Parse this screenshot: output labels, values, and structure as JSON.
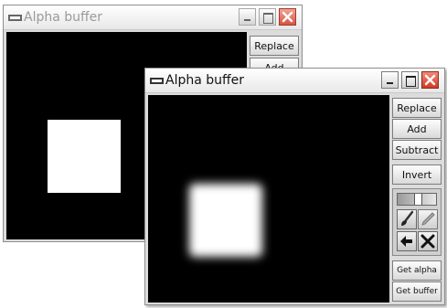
{
  "back_window": {
    "title": "Alpha buffer",
    "buttons": {
      "replace": "Replace",
      "add": "Add"
    }
  },
  "front_window": {
    "title": "Alpha buffer",
    "buttons": {
      "replace": "Replace",
      "add": "Add",
      "subtract": "Subtract",
      "invert": "Invert",
      "get_alpha": "Get alpha",
      "get_buffer": "Get buffer"
    },
    "tools": [
      "brush-icon",
      "pencil-icon",
      "arrow-icon",
      "clear-icon"
    ]
  },
  "colors": {
    "canvas": "#000000",
    "shape": "#ffffff",
    "close": "#e04a3a"
  }
}
